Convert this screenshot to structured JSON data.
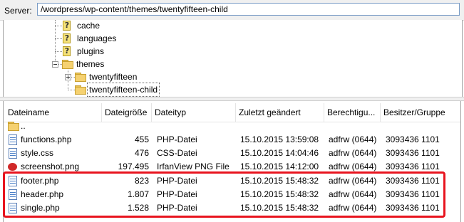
{
  "server_bar": {
    "label": "Server:",
    "path": "/wordpress/wp-content/themes/twentyfifteen-child"
  },
  "tree": {
    "nodes": [
      {
        "label": "cache",
        "icon": "unknown-folder-icon"
      },
      {
        "label": "languages",
        "icon": "unknown-folder-icon"
      },
      {
        "label": "plugins",
        "icon": "unknown-folder-icon"
      },
      {
        "label": "themes",
        "icon": "open-folder-icon"
      },
      {
        "label": "twentyfifteen",
        "icon": "folder-icon"
      },
      {
        "label": "twentyfifteen-child",
        "icon": "folder-icon"
      }
    ]
  },
  "list": {
    "columns": [
      "Dateiname",
      "Dateigröße",
      "Dateityp",
      "Zuletzt geändert",
      "Berechtigu...",
      "Besitzer/Gruppe"
    ],
    "rows": [
      {
        "name": "..",
        "size": "",
        "type": "",
        "modified": "",
        "perm": "",
        "owner": "",
        "icon": "parent-folder-icon"
      },
      {
        "name": "functions.php",
        "size": "455",
        "type": "PHP-Datei",
        "modified": "15.10.2015 13:59:08",
        "perm": "adfrw (0644)",
        "owner": "3093436 1101",
        "icon": "php-file-icon"
      },
      {
        "name": "style.css",
        "size": "476",
        "type": "CSS-Datei",
        "modified": "15.10.2015 14:04:46",
        "perm": "adfrw (0644)",
        "owner": "3093436 1101",
        "icon": "css-file-icon"
      },
      {
        "name": "screenshot.png",
        "size": "197.495",
        "type": "IrfanView PNG File",
        "modified": "15.10.2015 14:12:00",
        "perm": "adfrw (0644)",
        "owner": "3093436 1101",
        "icon": "image-file-icon"
      },
      {
        "name": "footer.php",
        "size": "823",
        "type": "PHP-Datei",
        "modified": "15.10.2015 15:48:32",
        "perm": "adfrw (0644)",
        "owner": "3093436 1101",
        "icon": "php-file-icon"
      },
      {
        "name": "header.php",
        "size": "1.807",
        "type": "PHP-Datei",
        "modified": "15.10.2015 15:48:32",
        "perm": "adfrw (0644)",
        "owner": "3093436 1101",
        "icon": "php-file-icon"
      },
      {
        "name": "single.php",
        "size": "1.528",
        "type": "PHP-Datei",
        "modified": "15.10.2015 15:48:32",
        "perm": "adfrw (0644)",
        "owner": "3093436 1101",
        "icon": "php-file-icon"
      }
    ]
  },
  "highlight_color": "#e8141e"
}
